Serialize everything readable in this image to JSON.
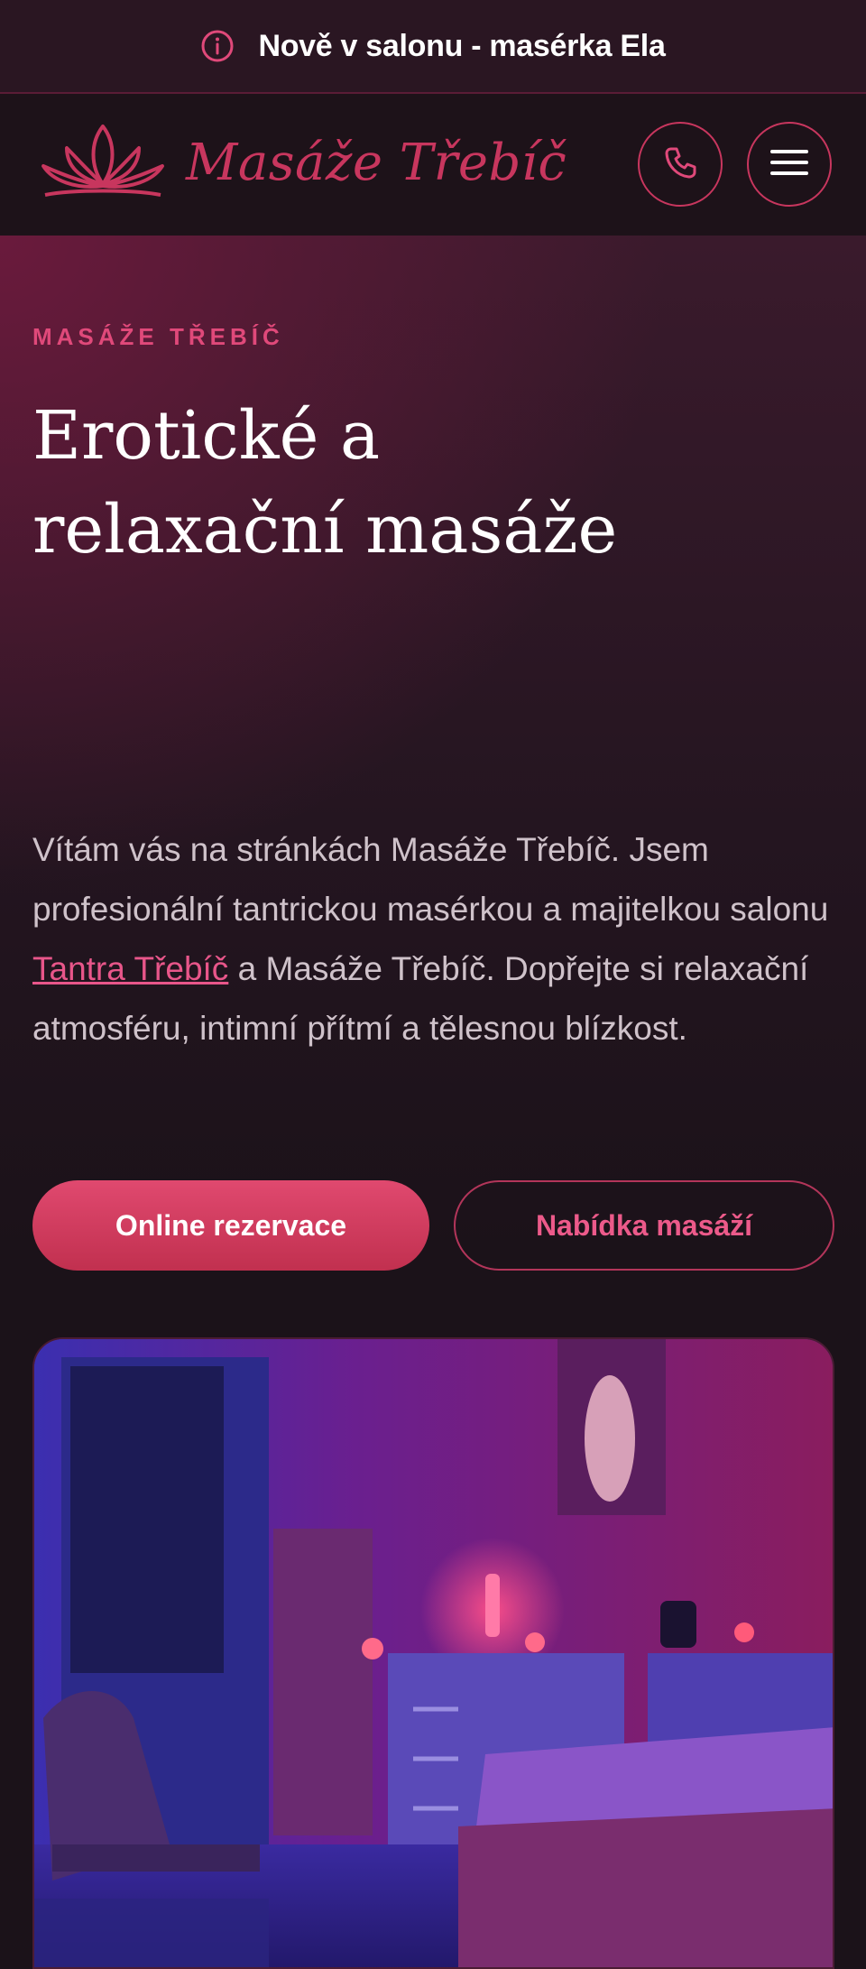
{
  "announcement": {
    "text": "Nově v salonu - masérka Ela",
    "icon": "info-icon"
  },
  "header": {
    "logo_text": "Masáže Třebíč",
    "logo_icon": "lotus-icon",
    "phone_button_icon": "phone-icon",
    "menu_button_icon": "hamburger-icon"
  },
  "hero": {
    "eyebrow": "MASÁŽE TŘEBÍČ",
    "title_line1": "Erotické a",
    "title_line2": "relaxační masáže",
    "intro_before": "Vítám vás na stránkách Masáže Třebíč. Jsem profesionální tantrickou masérkou a majitelkou salonu ",
    "intro_link": "Tantra Třebíč",
    "intro_after": " a Masáže Třebíč. Dopřejte si relaxační atmosféru, intimní přítmí a tělesnou blízkost.",
    "primary_button": "Online rezervace",
    "secondary_button": "Nabídka masáží"
  },
  "colors": {
    "accent": "#c8365e",
    "accent_light": "#e0497a",
    "background": "#1b1219",
    "announcement_bg": "#2a1622"
  }
}
